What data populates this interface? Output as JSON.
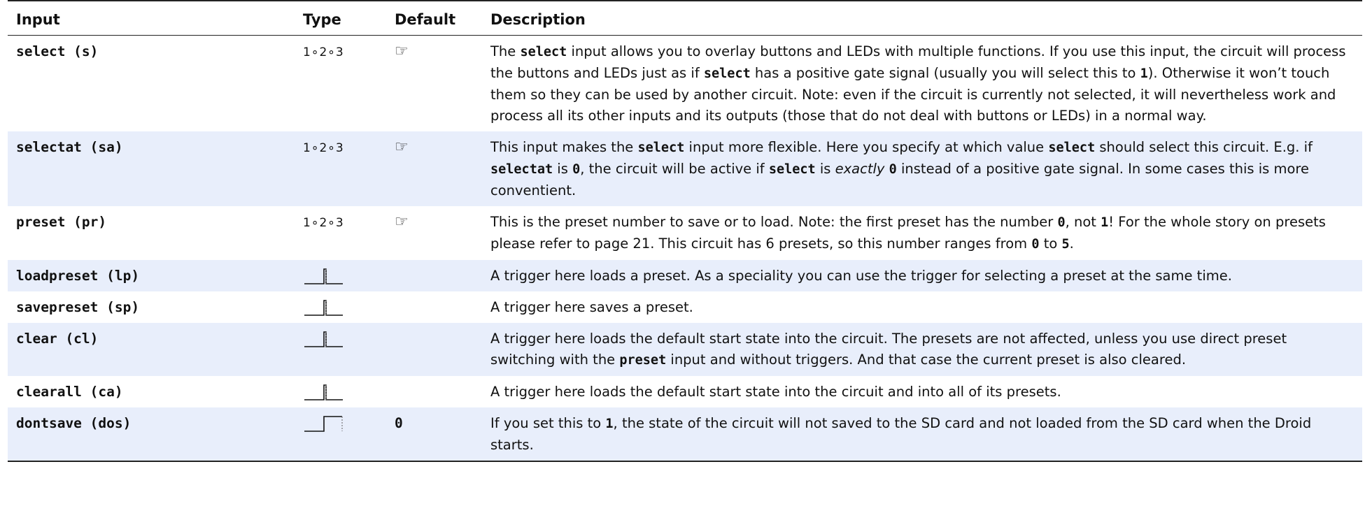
{
  "headers": {
    "input": "Input",
    "type": "Type",
    "default": "Default",
    "description": "Description"
  },
  "rows": [
    {
      "input": "select (s)",
      "type_text": "1∘2∘3",
      "type_icon": "",
      "default": "☞",
      "desc": [
        "The ",
        {
          "c": "select"
        },
        " input allows you to overlay buttons and LEDs with multiple functions. If you use this input, the circuit will process the buttons and LEDs just as if ",
        {
          "c": "select"
        },
        " has a positive gate signal (usually you will select this to ",
        {
          "c": "1"
        },
        "). Otherwise it won’t touch them so they can be used by another circuit. Note: even if the circuit is currently not selected, it will nevertheless work and process all its other inputs and its outputs (those that do not deal with buttons or LEDs) in a normal way."
      ]
    },
    {
      "input": "selectat (sa)",
      "type_text": "1∘2∘3",
      "type_icon": "",
      "default": "☞",
      "desc": [
        "This input makes the ",
        {
          "c": "select"
        },
        " input more flexible. Here you specify at which value ",
        {
          "c": "select"
        },
        " should select this circuit. E.g. if ",
        {
          "c": "selectat"
        },
        " is ",
        {
          "c": "0"
        },
        ", the circuit will be active if ",
        {
          "c": "select"
        },
        " is ",
        {
          "i": "exactly"
        },
        " ",
        {
          "c": "0"
        },
        " instead of a positive gate signal. In some cases this is more conventient."
      ]
    },
    {
      "input": "preset (pr)",
      "type_text": "1∘2∘3",
      "type_icon": "",
      "default": "☞",
      "desc": [
        "This is the preset number to save or to load. Note: the first preset has the number ",
        {
          "c": "0"
        },
        ", not ",
        {
          "c": "1"
        },
        "! For the whole story on presets please refer to page 21. This circuit has 6 presets, so this number ranges from ",
        {
          "c": "0"
        },
        " to ",
        {
          "c": "5"
        },
        "."
      ]
    },
    {
      "input": "loadpreset (lp)",
      "type_text": "",
      "type_icon": "trigger-icon",
      "default": "",
      "desc": [
        "A trigger here loads a preset. As a speciality you can use the trigger for selecting a preset at the same time."
      ]
    },
    {
      "input": "savepreset (sp)",
      "type_text": "",
      "type_icon": "trigger-icon",
      "default": "",
      "desc": [
        "A trigger here saves a preset."
      ]
    },
    {
      "input": "clear (cl)",
      "type_text": "",
      "type_icon": "trigger-icon",
      "default": "",
      "desc": [
        "A trigger here loads the default start state into the circuit. The presets are not affected, unless you use direct preset switching with the ",
        {
          "c": "preset"
        },
        " input and without triggers. And that case the current preset is also cleared."
      ]
    },
    {
      "input": "clearall (ca)",
      "type_text": "",
      "type_icon": "trigger-icon",
      "default": "",
      "desc": [
        "A trigger here loads the default start state into the circuit and into all of its presets."
      ]
    },
    {
      "input": "dontsave (dos)",
      "type_text": "",
      "type_icon": "gate-icon",
      "default": "0",
      "desc": [
        "If you set this to ",
        {
          "c": "1"
        },
        ", the state of the circuit will not saved to the SD card and not loaded from the SD card when the Droid starts."
      ]
    }
  ]
}
